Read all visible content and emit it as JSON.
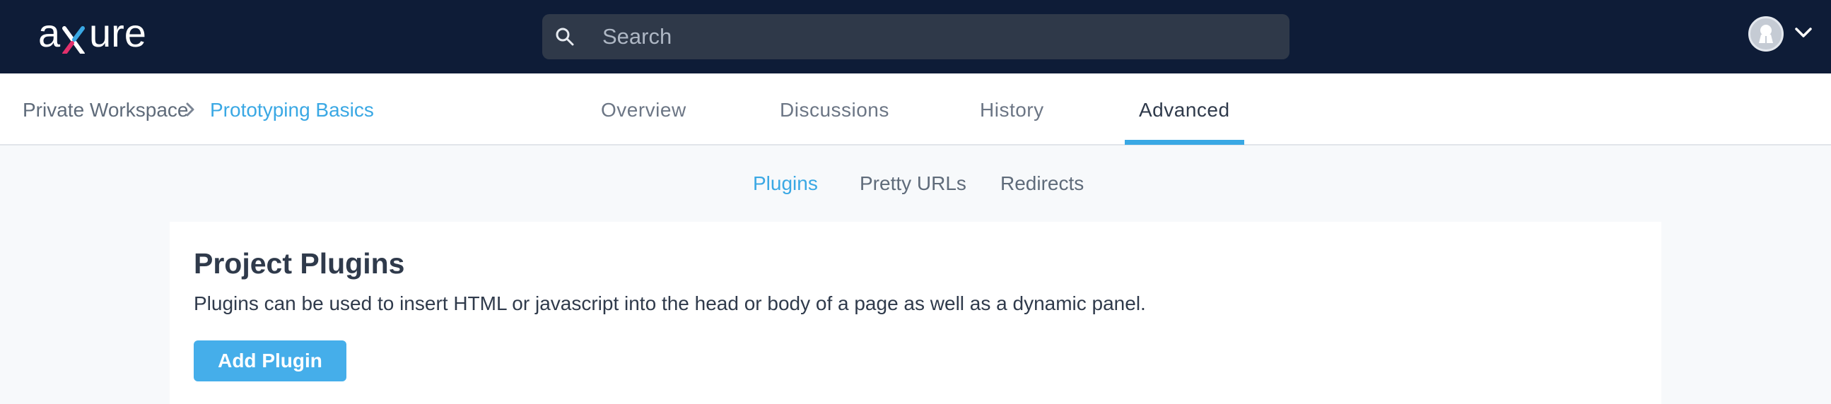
{
  "app": {
    "logo_text": "axure",
    "brand_colors": {
      "topbar": "#0e1c37",
      "accent": "#3aa8e4",
      "button": "#45aeea"
    }
  },
  "search": {
    "placeholder": "Search",
    "icon": "search-icon"
  },
  "user_menu": {
    "avatar_icon": "avatar-icon",
    "toggle_icon": "chevron-down-icon"
  },
  "breadcrumb": {
    "root": "Private Workspace",
    "separator_icon": "chevron-right-icon",
    "current": "Prototyping Basics"
  },
  "tabs": [
    {
      "label": "Overview",
      "active": false
    },
    {
      "label": "Discussions",
      "active": false
    },
    {
      "label": "History",
      "active": false
    },
    {
      "label": "Advanced",
      "active": true
    }
  ],
  "subtabs": [
    {
      "label": "Plugins",
      "active": true
    },
    {
      "label": "Pretty URLs",
      "active": false
    },
    {
      "label": "Redirects",
      "active": false
    }
  ],
  "plugins_section": {
    "title": "Project Plugins",
    "description": "Plugins can be used to insert HTML or javascript into the head or body of a page as well as a dynamic panel.",
    "add_button": "Add Plugin"
  }
}
